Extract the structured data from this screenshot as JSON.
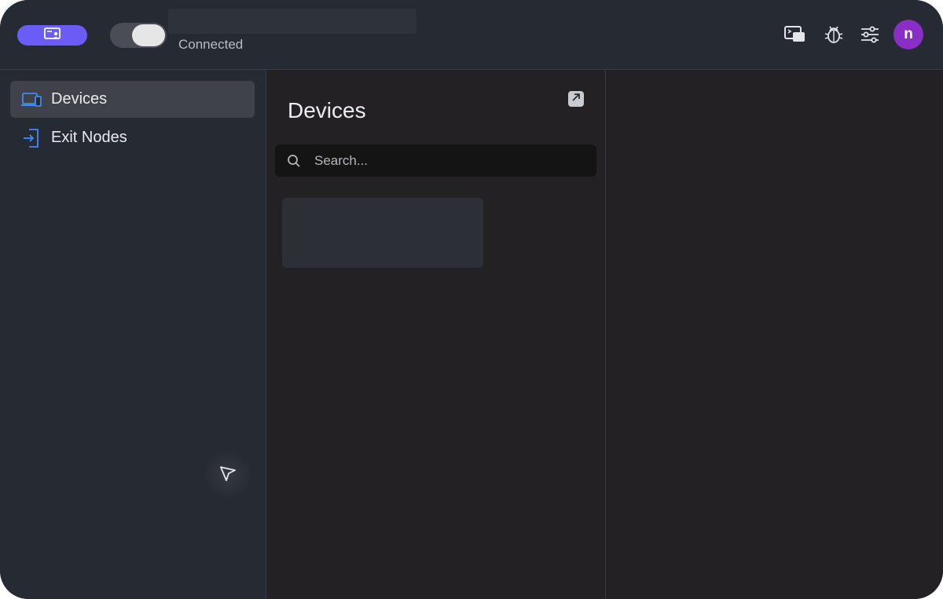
{
  "header": {
    "status_text": "Connected",
    "toggle_state": "on",
    "avatar_initial": "n",
    "icons": {
      "mode": "account-card-icon",
      "screen": "screen-share-icon",
      "debug": "bug-icon",
      "settings": "sliders-icon"
    }
  },
  "sidebar": {
    "items": [
      {
        "label": "Devices",
        "icon": "devices-icon",
        "active": true
      },
      {
        "label": "Exit Nodes",
        "icon": "exit-node-icon",
        "active": false
      }
    ]
  },
  "main": {
    "title": "Devices",
    "search": {
      "placeholder": "Search...",
      "value": ""
    }
  },
  "colors": {
    "accent": "#6b5cf6",
    "avatar": "#8a2fc6",
    "icon_blue": "#3d8bfd"
  }
}
